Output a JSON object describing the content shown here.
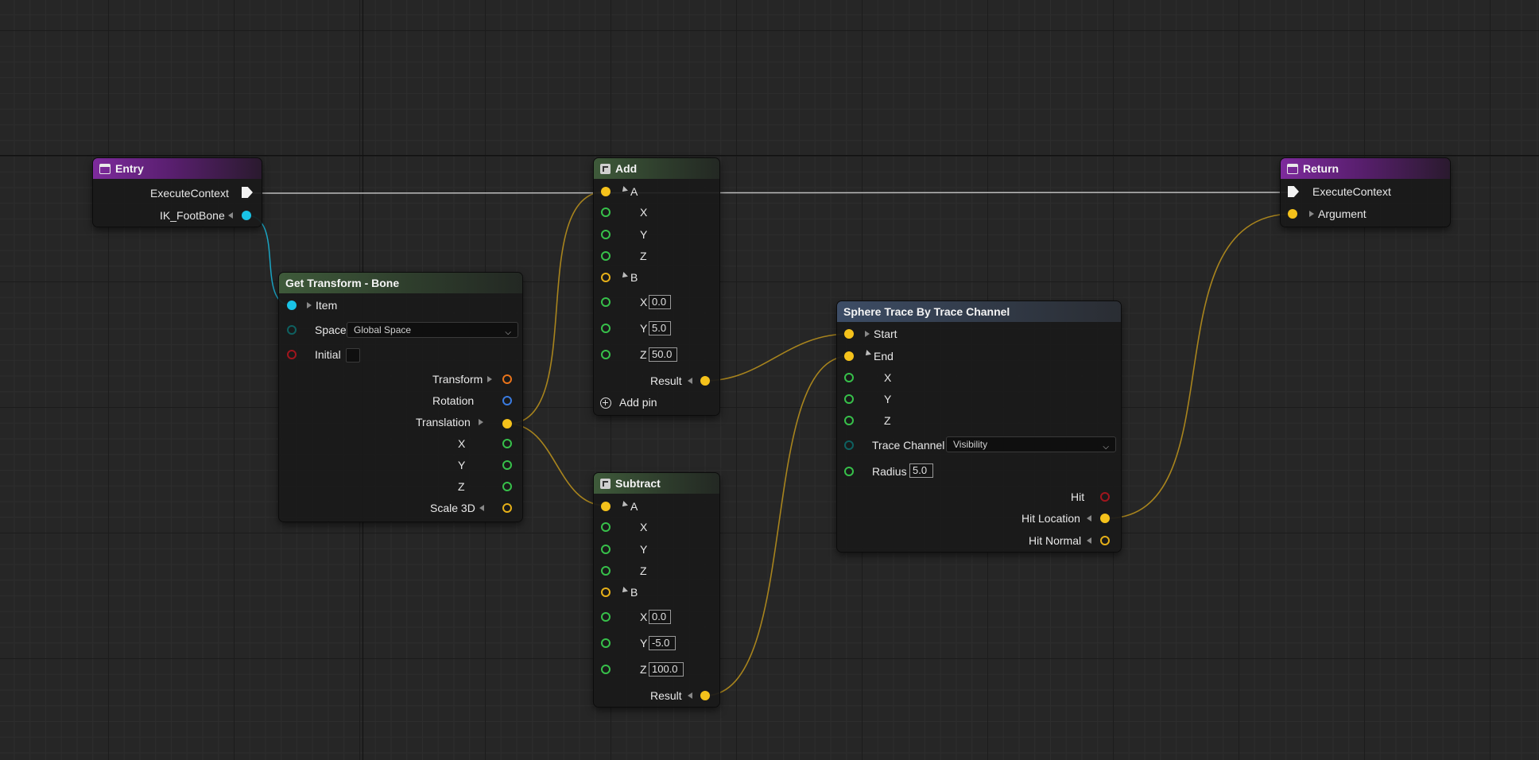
{
  "colors": {
    "execute": "#f2f2f2",
    "vector": "#f5c21b",
    "transform": "#e8731a",
    "rotation": "#3a7be0",
    "float": "#37c04a",
    "name": "#19c3e6",
    "bool": "#a0151d",
    "enum": "#0e6060",
    "vector_hollow": "#e6b018"
  },
  "entry": {
    "title": "Entry",
    "icon": "event-icon",
    "pins": {
      "execute_context": "ExecuteContext",
      "ik_footbone": "IK_FootBone"
    }
  },
  "get_transform": {
    "title": "Get Transform - Bone",
    "icon": "function-icon",
    "item": "Item",
    "space_label": "Space",
    "space_value": "Global Space",
    "initial_label": "Initial",
    "outputs": {
      "transform": "Transform",
      "rotation": "Rotation",
      "translation": "Translation",
      "x": "X",
      "y": "Y",
      "z": "Z",
      "scale": "Scale 3D"
    }
  },
  "add": {
    "title": "Add",
    "icon": "function-icon",
    "a": "A",
    "b": "B",
    "x": "X",
    "y": "Y",
    "z": "Z",
    "b_x": "0.0",
    "b_y": "5.0",
    "b_z": "50.0",
    "result": "Result",
    "add_pin": "Add pin"
  },
  "subtract": {
    "title": "Subtract",
    "icon": "function-icon",
    "a": "A",
    "b": "B",
    "x": "X",
    "y": "Y",
    "z": "Z",
    "b_x": "0.0",
    "b_y": "-5.0",
    "b_z": "100.0",
    "result": "Result"
  },
  "sphere_trace": {
    "title": "Sphere Trace By Trace Channel",
    "start": "Start",
    "end": "End",
    "x": "X",
    "y": "Y",
    "z": "Z",
    "trace_channel_label": "Trace Channel",
    "trace_channel_value": "Visibility",
    "radius_label": "Radius",
    "radius_value": "5.0",
    "hit": "Hit",
    "hit_location": "Hit Location",
    "hit_normal": "Hit Normal"
  },
  "return_node": {
    "title": "Return",
    "icon": "event-icon",
    "execute_context": "ExecuteContext",
    "argument": "Argument"
  }
}
